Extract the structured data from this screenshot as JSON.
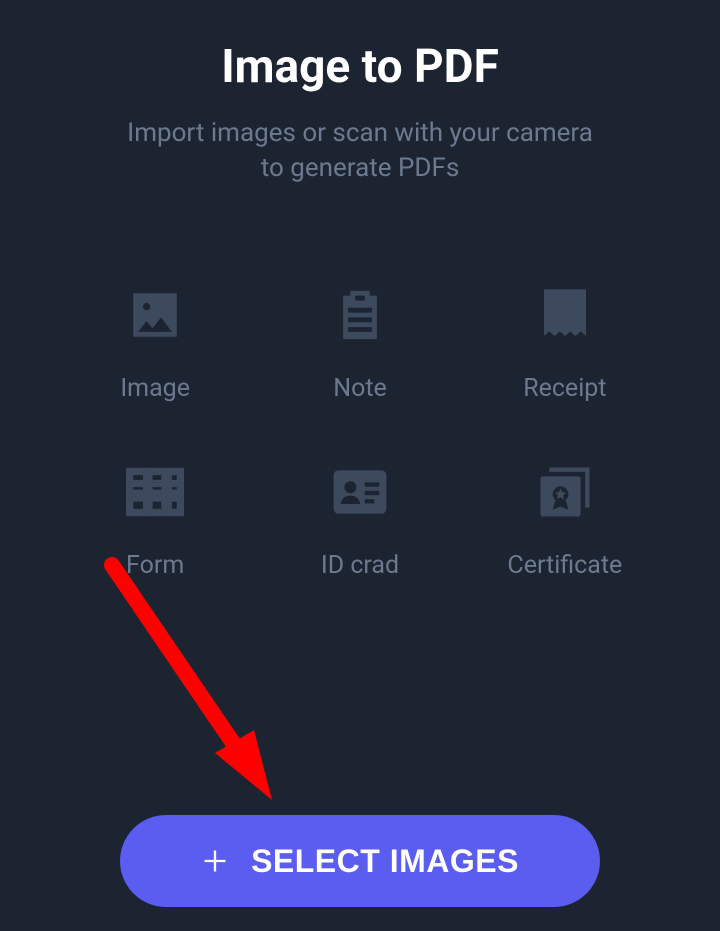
{
  "title": "Image to PDF",
  "subtitle": "Import images or scan with your camera to generate PDFs",
  "tiles": [
    {
      "label": "Image"
    },
    {
      "label": "Note"
    },
    {
      "label": "Receipt"
    },
    {
      "label": "Form"
    },
    {
      "label": "ID crad"
    },
    {
      "label": "Certificate"
    }
  ],
  "select_button": "SELECT IMAGES"
}
